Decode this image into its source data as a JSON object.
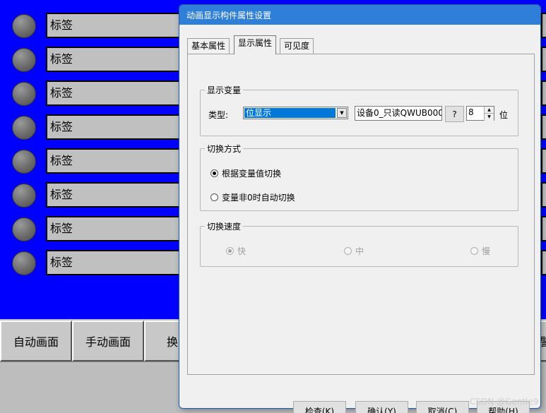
{
  "hmi": {
    "tag_label": "标签",
    "rows": 8,
    "nav_buttons": [
      "自动画面",
      "手动画面",
      "换",
      "警"
    ]
  },
  "dialog": {
    "title": "动画显示构件属性设置",
    "tabs": [
      "基本属性",
      "显示属性",
      "可见度"
    ],
    "display_variable": {
      "group_label": "显示变量",
      "type_label": "类型:",
      "type_value": "位显示",
      "variable": "设备0_只读QWUB000",
      "help_button": "?",
      "bit_value": "8",
      "bit_unit": "位"
    },
    "switch_mode": {
      "group_label": "切换方式",
      "options": [
        "根据变量值切换",
        "变量非0时自动切换"
      ],
      "selected": 0
    },
    "switch_speed": {
      "group_label": "切换速度",
      "options": [
        "快",
        "中",
        "慢"
      ],
      "selected": 0,
      "disabled": true
    },
    "buttons": [
      "检查(K)",
      "确认(Y)",
      "取消(C)",
      "帮助(H)"
    ]
  },
  "watermark": "CSDN @Gentle9"
}
